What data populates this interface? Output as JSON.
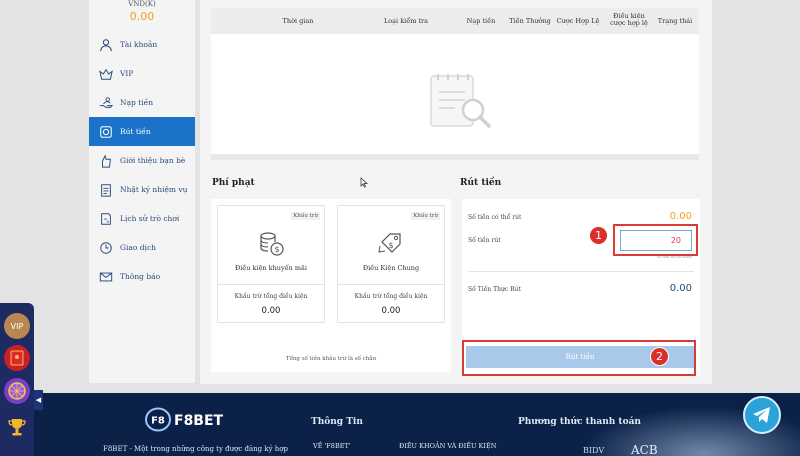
{
  "sidebar": {
    "balance_label": "VND(K)",
    "balance_value": "0.00",
    "items": [
      {
        "label": "Tài khoản",
        "icon": "user-icon"
      },
      {
        "label": "VIP",
        "icon": "vip-icon"
      },
      {
        "label": "Nạp tiền",
        "icon": "deposit-icon"
      },
      {
        "label": "Rút tiền",
        "icon": "withdraw-icon",
        "active": true
      },
      {
        "label": "Giới thiệu bạn bè",
        "icon": "refer-friends-icon"
      },
      {
        "label": "Nhật ký nhiệm vụ",
        "icon": "task-log-icon"
      },
      {
        "label": "Lịch sử trò chơi",
        "icon": "game-history-icon"
      },
      {
        "label": "Giao dịch",
        "icon": "transactions-icon"
      },
      {
        "label": "Thông báo",
        "icon": "notifications-icon"
      }
    ]
  },
  "table": {
    "columns": [
      "Thời gian",
      "Loại kiểm tra",
      "Nạp tiền",
      "Tiền Thưởng",
      "Cược Hợp Lệ",
      "Điều kiện cược hợp lệ",
      "Trạng thái"
    ]
  },
  "penalty": {
    "title": "Phí phạt",
    "cards": [
      {
        "tag": "Khấu trừ",
        "name": "Điều kiện khuyến mãi",
        "sub": "Khấu trừ tổng điều kiện",
        "value": "0.00"
      },
      {
        "tag": "Khấu trừ",
        "name": "Điều Kiện Chung",
        "sub": "Khấu trừ tổng điều kiện",
        "value": "0.00"
      }
    ],
    "note": "Tổng số tiền khấu trừ là số chẵn"
  },
  "withdraw": {
    "title": "Rút tiền",
    "available_label": "Số tiền có thể rút",
    "available_value": "0.00",
    "amount_label": "Số tiền rút",
    "amount_value": "20",
    "hint": "Số tiền rút tối thiểu",
    "actual_label": "Số Tiền Thực Rút",
    "actual_value": "0.00",
    "button_label": "Rút tiền"
  },
  "markers": [
    "1",
    "2"
  ],
  "footer": {
    "brand": "F8BET",
    "tagline": "F8BET - Một trong những công ty được đăng ký hợp",
    "info_title": "Thông Tin",
    "info_link_1": "VỀ 'F8BET'",
    "info_link_2": "ĐIỀU KHOẢN VÀ ĐIỀU KIỆN",
    "payment_title": "Phương thức thanh toán",
    "bank_1": "BIDV",
    "bank_2": "ACB"
  },
  "float_bar": {
    "vip_label": "VIP"
  },
  "colors": {
    "accent": "#1a73c8",
    "balance": "#f0a318",
    "highlight": "#d93b37",
    "footer": "#0b2147"
  }
}
